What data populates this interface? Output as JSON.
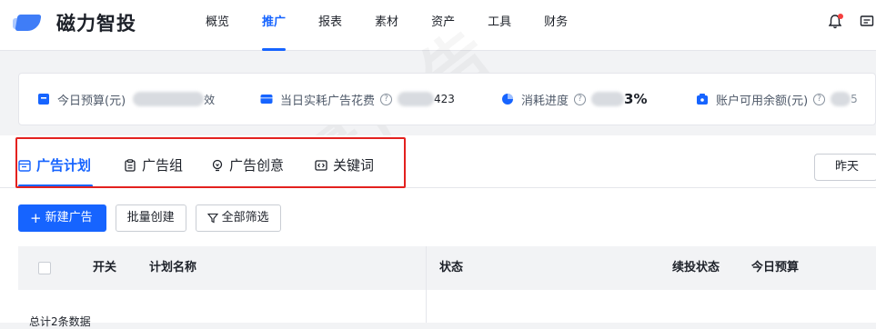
{
  "app": {
    "name": "磁力智投"
  },
  "nav": {
    "items": [
      {
        "label": "概览",
        "active": false
      },
      {
        "label": "推广",
        "active": true
      },
      {
        "label": "报表",
        "active": false
      },
      {
        "label": "素材",
        "active": false
      },
      {
        "label": "资产",
        "active": false
      },
      {
        "label": "工具",
        "active": false
      },
      {
        "label": "财务",
        "active": false
      }
    ]
  },
  "stats": {
    "today_budget": {
      "label": "今日预算(元)",
      "value_tail": "效",
      "icon": "budget-icon",
      "color": "#1664ff"
    },
    "spend": {
      "label": "当日实耗广告花费",
      "value_tail": "423",
      "icon": "wallet-icon",
      "color": "#1664ff"
    },
    "progress": {
      "label": "消耗进度",
      "value_tail": "3%",
      "icon": "pie-icon",
      "color": "#1664ff"
    },
    "balance": {
      "label": "账户可用余额(元)",
      "value_tail": "5",
      "icon": "balance-icon",
      "color": "#1664ff"
    }
  },
  "tabs": [
    {
      "label": "广告计划",
      "icon": "calendar-icon",
      "active": true
    },
    {
      "label": "广告组",
      "icon": "clipboard-icon",
      "active": false
    },
    {
      "label": "广告创意",
      "icon": "bulb-icon",
      "active": false
    },
    {
      "label": "关键词",
      "icon": "keyword-icon",
      "active": false
    }
  ],
  "date_filter": {
    "label": "昨天"
  },
  "toolbar": {
    "new_label": "新建广告",
    "batch_label": "批量创建",
    "filter_label": "全部筛选"
  },
  "table": {
    "headers": {
      "switch": "开关",
      "plan_name": "计划名称",
      "status": "状态",
      "continue_status": "续投状态",
      "today_budget": "今日预算"
    },
    "summary": "总计2条数据"
  },
  "watermark": "巨量广告",
  "colors": {
    "accent": "#1664ff",
    "highlight": "#e3211f",
    "alert": "#f53f3f"
  }
}
